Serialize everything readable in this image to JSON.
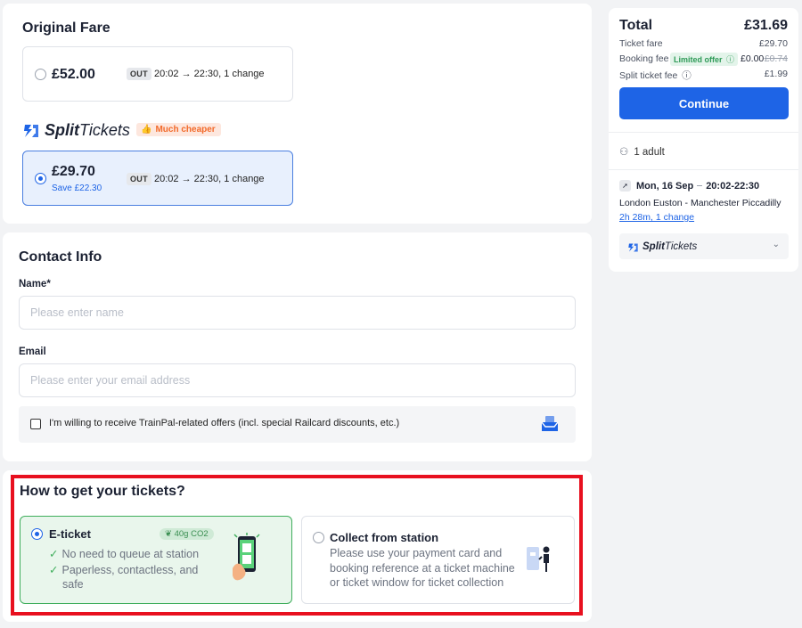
{
  "fare": {
    "original_title": "Original Fare",
    "original_price": "£52.00",
    "out_tag": "OUT",
    "times": "20:02 → 22:30, 1 change",
    "split_brand_bold": "Split",
    "split_brand_light": "Tickets",
    "cheaper_badge": "Much cheaper",
    "split_price": "£29.70",
    "split_save": "Save £22.30"
  },
  "contact": {
    "title": "Contact Info",
    "name_label": "Name*",
    "name_placeholder": "Please enter name",
    "email_label": "Email",
    "email_placeholder": "Please enter your email address",
    "offers_text": "I'm willing to receive TrainPal-related offers (incl. special Railcard discounts, etc.)"
  },
  "delivery": {
    "title": "How to get your tickets?",
    "eticket_title": "E-ticket",
    "co2_badge": "40g CO2",
    "eticket_point1": "No need to queue at station",
    "eticket_point2a": "Paperless, contactless, and",
    "eticket_point2b": "safe",
    "collect_title": "Collect from station",
    "collect_line1": "Please use your payment card and",
    "collect_line2": "booking reference at a ticket machine",
    "collect_line3": "or ticket window for ticket collection"
  },
  "summary": {
    "total_label": "Total",
    "total_value": "£31.69",
    "ticket_fare_label": "Ticket fare",
    "ticket_fare_value": "£29.70",
    "booking_fee_label": "Booking fee",
    "limited_offer": "Limited offer",
    "booking_fee_value": "£0.00",
    "booking_fee_old": "£0.74",
    "split_fee_label": "Split ticket fee",
    "split_fee_value": "£1.99",
    "continue_label": "Continue",
    "passengers": "1 adult",
    "date": "Mon, 16 Sep",
    "time_range": "20:02-22:30",
    "route": "London Euston - Manchester Piccadilly",
    "duration_link": "2h 28m, 1 change",
    "split_brand_bold": "Split",
    "split_brand_light": "Tickets"
  },
  "colors": {
    "primary": "#1e64e6",
    "highlight_frame": "#e8101f",
    "eticket_bg": "#e9f6ec",
    "eticket_border": "#3fae5c",
    "cheaper_badge": "#f26a2a"
  }
}
